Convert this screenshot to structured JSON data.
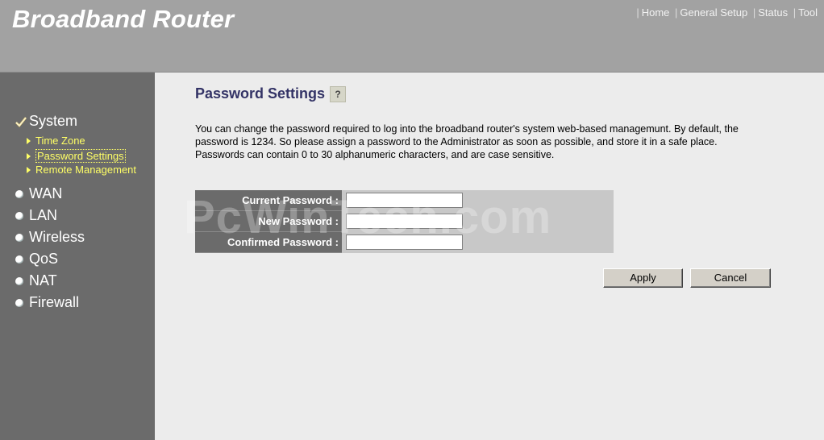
{
  "header": {
    "brand": "Broadband Router",
    "nav": [
      "Home",
      "General Setup",
      "Status",
      "Tool"
    ]
  },
  "sidebar": {
    "system_label": "System",
    "sub_items": [
      "Time Zone",
      "Password Settings",
      "Remote Management"
    ],
    "items": [
      "WAN",
      "LAN",
      "Wireless",
      "QoS",
      "NAT",
      "Firewall"
    ]
  },
  "main": {
    "title": "Password Settings",
    "help_icon": "?",
    "description": "You can change the password required to log into the broadband router's system web-based managemunt. By default, the password is 1234. So please assign a password to the Administrator as soon as possible, and store it in a safe place. Passwords can contain 0 to 30 alphanumeric characters, and are case sensitive.",
    "fields": {
      "current_label": "Current Password :",
      "new_label": "New Password :",
      "confirm_label": "Confirmed Password :",
      "current_value": "",
      "new_value": "",
      "confirm_value": ""
    },
    "apply_label": "Apply",
    "cancel_label": "Cancel"
  },
  "watermark": "PcWinTech.com"
}
